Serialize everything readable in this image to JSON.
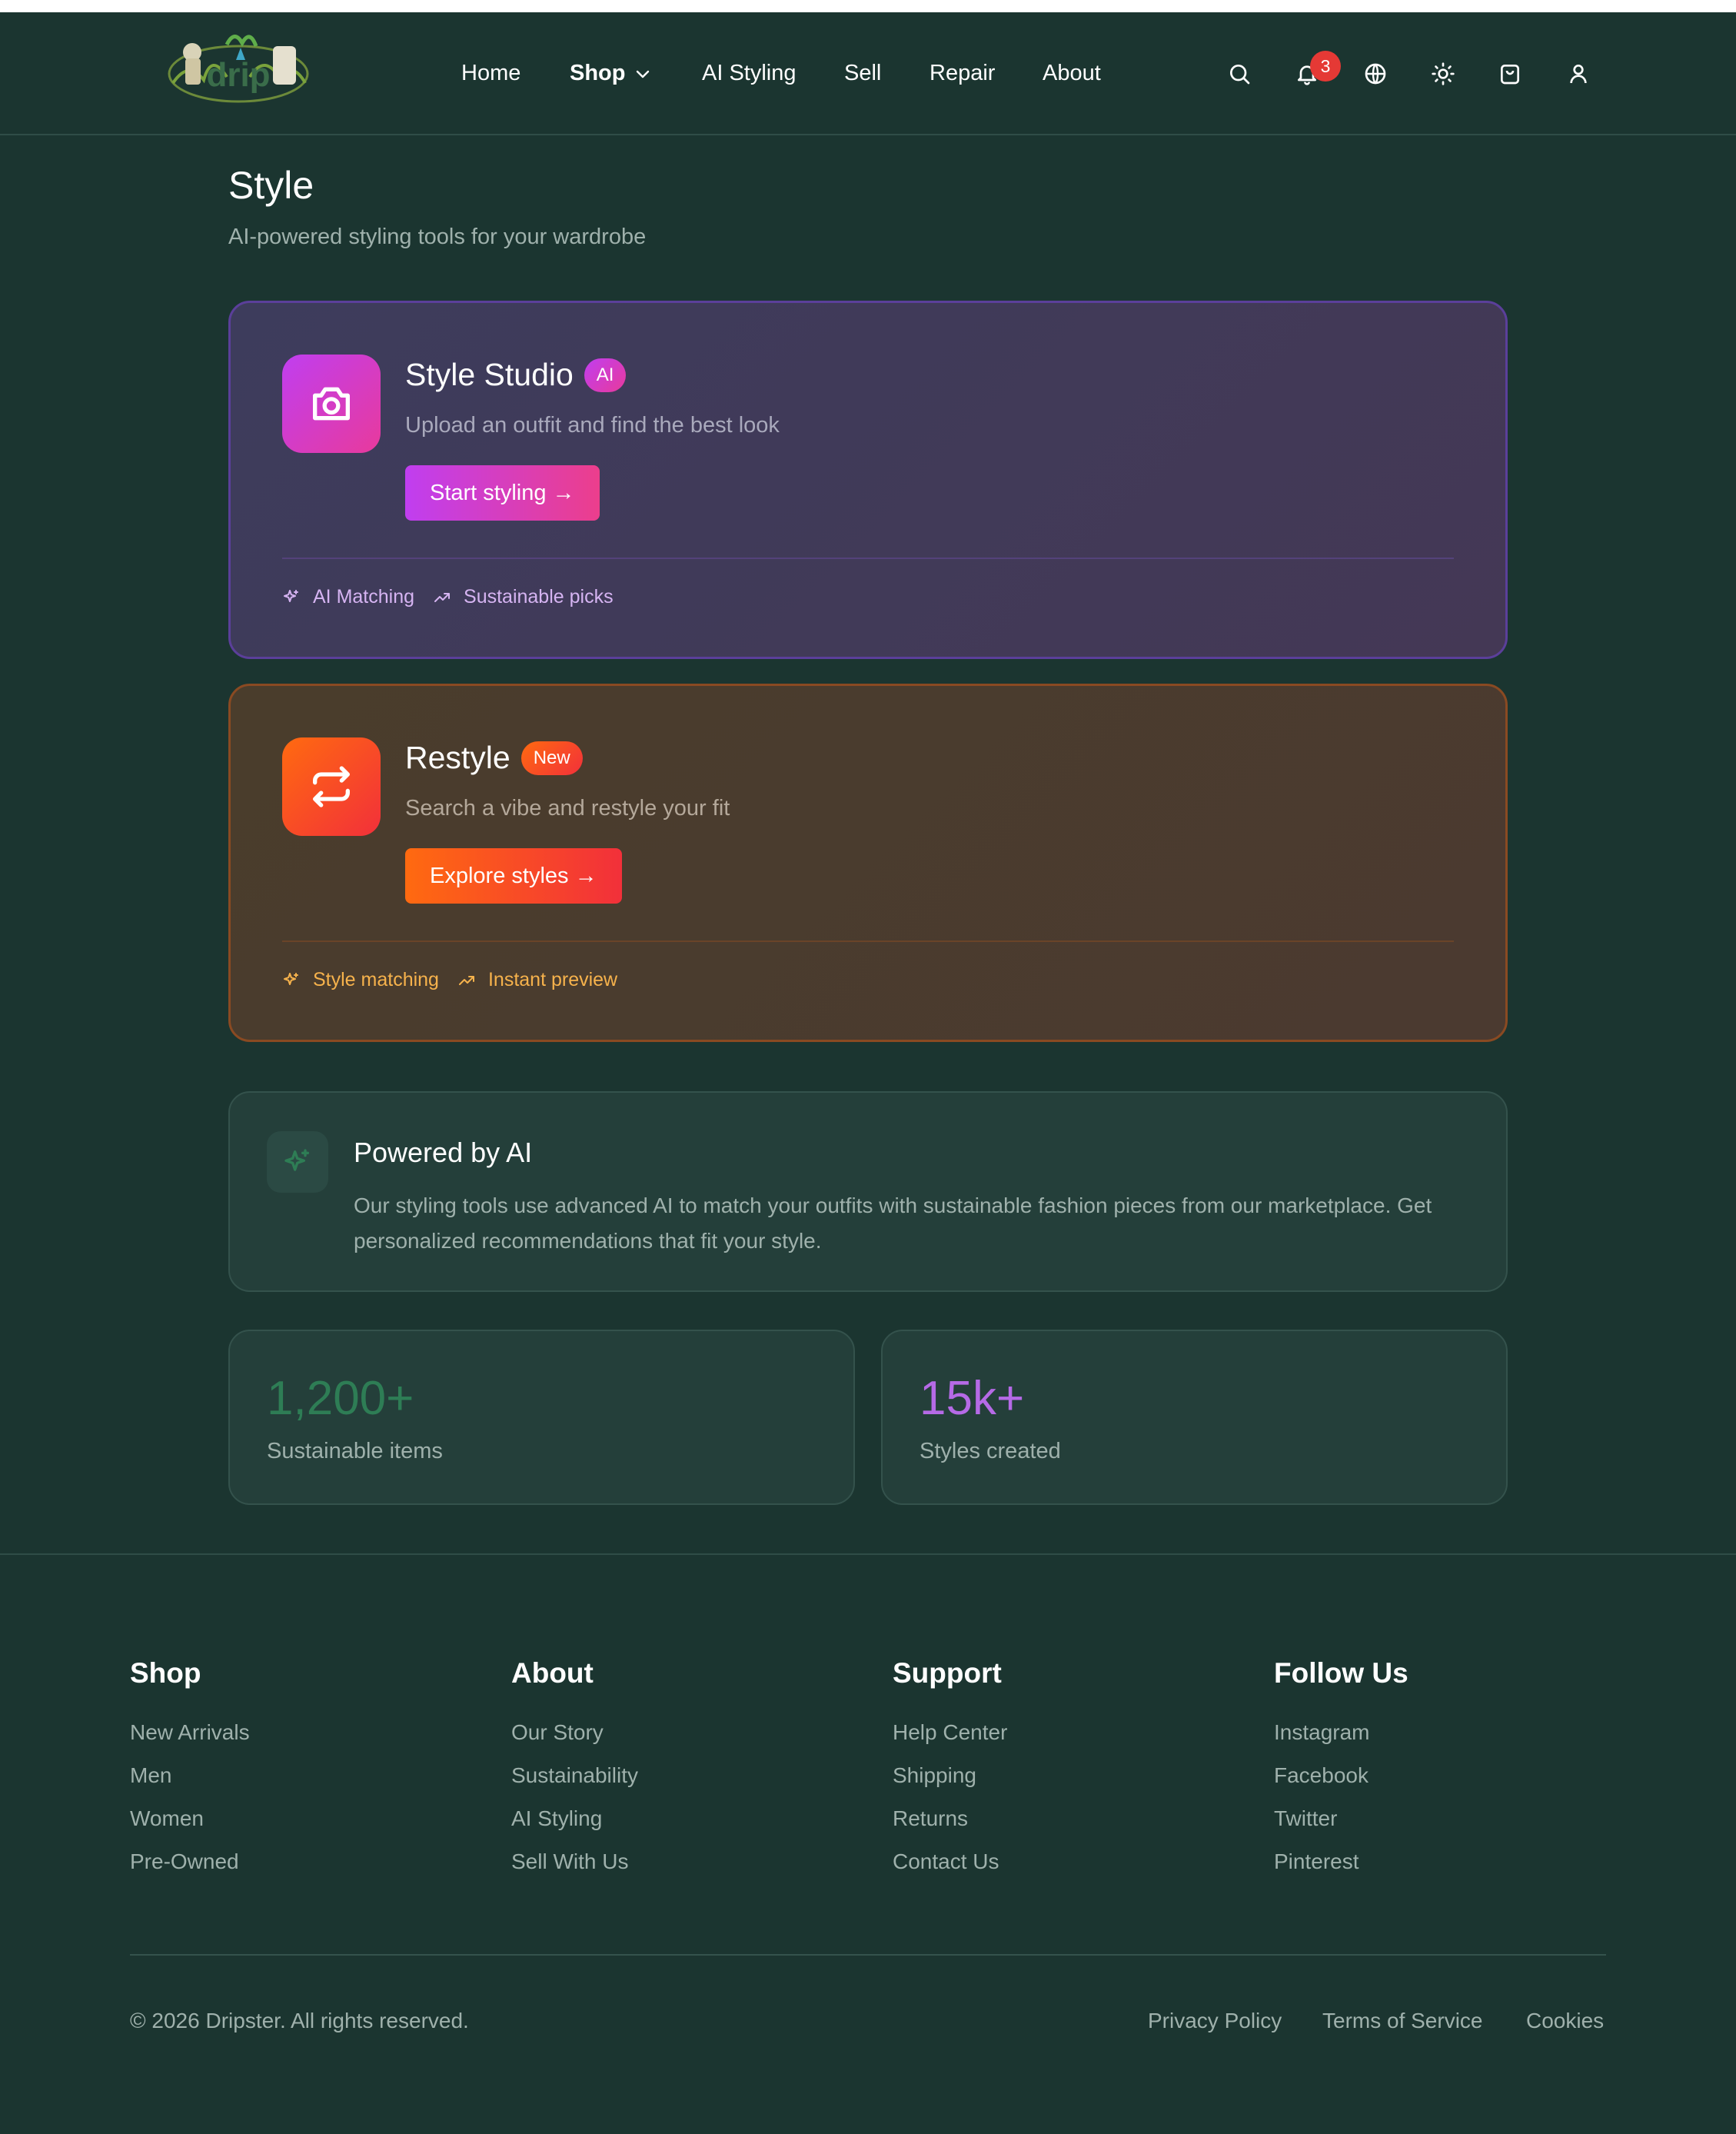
{
  "brand": {
    "logo_text": "drip"
  },
  "nav": {
    "items": [
      {
        "label": "Home"
      },
      {
        "label": "Shop"
      },
      {
        "label": "AI Styling"
      },
      {
        "label": "Sell"
      },
      {
        "label": "Repair"
      },
      {
        "label": "About"
      }
    ],
    "notification_count": "3",
    "icons": [
      "search-icon",
      "bell-icon",
      "globe-icon",
      "sun-icon",
      "shopping-bag-icon",
      "user-icon"
    ]
  },
  "page": {
    "title": "Style",
    "subtitle": "AI-powered styling tools for your wardrobe"
  },
  "cards": [
    {
      "title": "Style Studio",
      "badge": "AI",
      "description": "Upload an outfit and find the best look",
      "button": "Start styling →",
      "features": [
        "AI Matching",
        "Sustainable picks"
      ],
      "accent": "#c03ef0"
    },
    {
      "title": "Restyle",
      "badge": "New",
      "description": "Search a vibe and restyle your fit",
      "button": "Explore styles →",
      "features": [
        "Style matching",
        "Instant preview"
      ],
      "accent": "#ff6a10"
    }
  ],
  "ai_info": {
    "title": "Powered by AI",
    "text": "Our styling tools use advanced AI to match your outfits with sustainable fashion pieces from our marketplace. Get personalized recommendations that fit your style."
  },
  "stats": [
    {
      "value": "1,200+",
      "label": "Sustainable items",
      "color": "#2e7d55"
    },
    {
      "value": "15k+",
      "label": "Styles created",
      "color": "#b56ae6"
    }
  ],
  "footer": {
    "columns": [
      {
        "heading": "Shop",
        "links": [
          "New Arrivals",
          "Men",
          "Women",
          "Pre-Owned"
        ]
      },
      {
        "heading": "About",
        "links": [
          "Our Story",
          "Sustainability",
          "AI Styling",
          "Sell With Us"
        ]
      },
      {
        "heading": "Support",
        "links": [
          "Help Center",
          "Shipping",
          "Returns",
          "Contact Us"
        ]
      },
      {
        "heading": "Follow Us",
        "links": [
          "Instagram",
          "Facebook",
          "Twitter",
          "Pinterest"
        ]
      }
    ],
    "copyright": "© 2026 Dripster. All rights reserved.",
    "legal": [
      "Privacy Policy",
      "Terms of Service",
      "Cookies"
    ]
  }
}
